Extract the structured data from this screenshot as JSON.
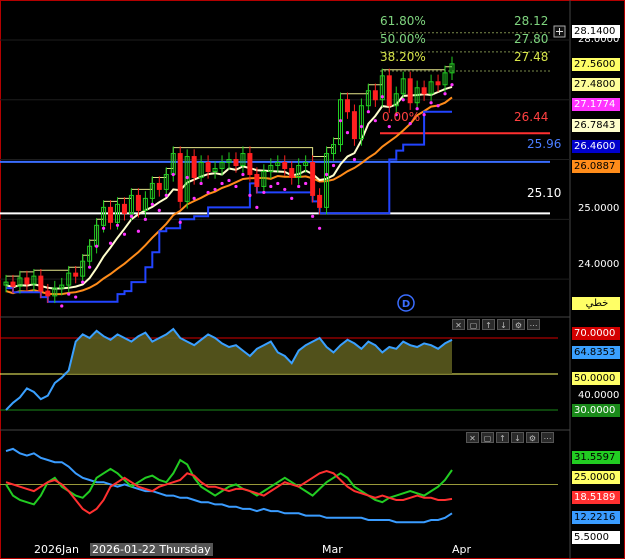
{
  "chart_data": [
    {
      "type": "candlestick",
      "title": "",
      "ylim": [
        23.4,
        28.3
      ],
      "y_axis_ticks": [
        "28.0000",
        "25.0000",
        "24.0000"
      ],
      "fibonacci": [
        {
          "pct": "61.80%",
          "value": "28.12"
        },
        {
          "pct": "50.00%",
          "value": "27.80"
        },
        {
          "pct": "38.20%",
          "value": "27.48"
        },
        {
          "pct": "0.00%",
          "value": "26.44"
        }
      ],
      "horizontal_levels": [
        {
          "value": "26.44",
          "color": "#ff3030"
        },
        {
          "value": "25.96",
          "color": "#3a6dff"
        },
        {
          "value": "25.10",
          "color": "#ffffff"
        }
      ],
      "price_tags": [
        {
          "text": "28.1400",
          "bg": "#ffffff",
          "fg": "#000000"
        },
        {
          "text": "27.5600",
          "bg": "#ffff66",
          "fg": "#000000"
        },
        {
          "text": "27.4800",
          "bg": "#ffff99",
          "fg": "#000000"
        },
        {
          "text": "27.1774",
          "bg": "#ff33ff",
          "fg": "#ffffff"
        },
        {
          "text": "26.7843",
          "bg": "#ffffcc",
          "fg": "#000000"
        },
        {
          "text": "26.4600",
          "bg": "#0000cc",
          "fg": "#ffffff"
        },
        {
          "text": "26.0887",
          "bg": "#ff8c1a",
          "fg": "#000000"
        }
      ],
      "close": [
        23.95,
        23.88,
        24.02,
        23.92,
        24.05,
        23.8,
        23.72,
        23.85,
        23.9,
        24.1,
        24.05,
        24.3,
        24.55,
        24.9,
        25.2,
        24.95,
        25.25,
        25.1,
        25.4,
        25.15,
        25.35,
        25.6,
        25.5,
        25.75,
        26.1,
        25.3,
        26.05,
        25.7,
        25.95,
        25.8,
        25.85,
        25.95,
        26.0,
        25.9,
        26.1,
        25.75,
        25.55,
        25.8,
        25.9,
        25.95,
        25.85,
        25.7,
        25.9,
        25.95,
        25.4,
        25.2,
        26.1,
        26.25,
        27.0,
        26.8,
        26.35,
        26.9,
        27.15,
        27.0,
        27.4,
        26.9,
        27.1,
        27.35,
        26.95,
        27.2,
        27.1,
        27.3,
        27.25,
        27.45,
        27.6
      ],
      "legend_label": "خطي"
    },
    {
      "type": "line",
      "ylim": [
        20,
        80
      ],
      "levels": [
        {
          "text": "70.0000",
          "bg": "#d40000",
          "fg": "#ffffff"
        },
        {
          "text": "50.0000",
          "bg": "#ffff66",
          "fg": "#000000"
        },
        {
          "text": "30.0000",
          "bg": "#1a8a1a",
          "fg": "#ffffff"
        }
      ],
      "tags": [
        {
          "text": "64.8353",
          "bg": "#3aa0ff",
          "fg": "#000000"
        }
      ],
      "axis_ticks": [
        "40.0000"
      ],
      "series": [
        {
          "values": [
            30,
            34,
            37,
            42,
            40,
            36,
            38,
            45,
            48,
            52,
            68,
            72,
            70,
            74,
            71,
            69,
            72,
            70,
            68,
            71,
            73,
            68,
            70,
            72,
            75,
            70,
            68,
            66,
            69,
            72,
            70,
            67,
            65,
            66,
            63,
            60,
            64,
            66,
            68,
            62,
            60,
            56,
            63,
            66,
            68,
            70,
            65,
            62,
            66,
            69,
            67,
            64,
            68,
            66,
            62,
            65,
            64,
            68,
            66,
            65,
            67,
            66,
            64,
            67,
            69
          ]
        }
      ]
    },
    {
      "type": "line",
      "ylim": [
        0,
        45
      ],
      "tags": [
        {
          "text": "31.5597",
          "bg": "#22cc22",
          "fg": "#000000"
        },
        {
          "text": "25.0000",
          "bg": "#ffff66",
          "fg": "#000000"
        },
        {
          "text": "18.5189",
          "bg": "#ff3030",
          "fg": "#ffffff"
        },
        {
          "text": "12.2216",
          "bg": "#3a9cff",
          "fg": "#000000"
        },
        {
          "text": "5.5000",
          "bg": "#ffffff",
          "fg": "#000000"
        }
      ],
      "series": [
        {
          "values": [
            40,
            41,
            39,
            38,
            39,
            37,
            36,
            35,
            35,
            33,
            30,
            28,
            27,
            26,
            26,
            25,
            24,
            25,
            24,
            23,
            22,
            22,
            21,
            20,
            20,
            19,
            19,
            18,
            17,
            17,
            16,
            16,
            15,
            15,
            14,
            14,
            13,
            14,
            13,
            13,
            12,
            12,
            12,
            11,
            11,
            11,
            10,
            10,
            10,
            10,
            10,
            10,
            9,
            9,
            9,
            9,
            8,
            8,
            8,
            8,
            8,
            9,
            9,
            10,
            12
          ]
        },
        {
          "values": [
            25,
            20,
            18,
            17,
            16,
            20,
            26,
            28,
            24,
            22,
            20,
            19,
            22,
            28,
            30,
            32,
            30,
            27,
            24,
            26,
            28,
            29,
            27,
            26,
            30,
            36,
            34,
            28,
            24,
            22,
            20,
            22,
            24,
            25,
            23,
            22,
            20,
            22,
            24,
            26,
            28,
            26,
            24,
            22,
            20,
            23,
            26,
            28,
            30,
            28,
            24,
            22,
            20,
            18,
            17,
            19,
            20,
            21,
            22,
            21,
            20,
            22,
            24,
            27,
            31.5
          ]
        },
        {
          "values": [
            26,
            25,
            24,
            23,
            22,
            24,
            26,
            27,
            25,
            22,
            18,
            14,
            12,
            14,
            18,
            24,
            26,
            28,
            26,
            24,
            23,
            22,
            24,
            25,
            26,
            27,
            30,
            29,
            26,
            24,
            24,
            23,
            22,
            23,
            23,
            22,
            21,
            20,
            22,
            24,
            26,
            25,
            24,
            26,
            28,
            30,
            31,
            30,
            27,
            24,
            22,
            21,
            20,
            19,
            20,
            19,
            18,
            18,
            19,
            20,
            19,
            19,
            18,
            18,
            18.5
          ]
        }
      ]
    }
  ],
  "x_axis": [
    "2026Jan",
    "2026-01-22 Thursday",
    "Mar",
    "Apr"
  ]
}
